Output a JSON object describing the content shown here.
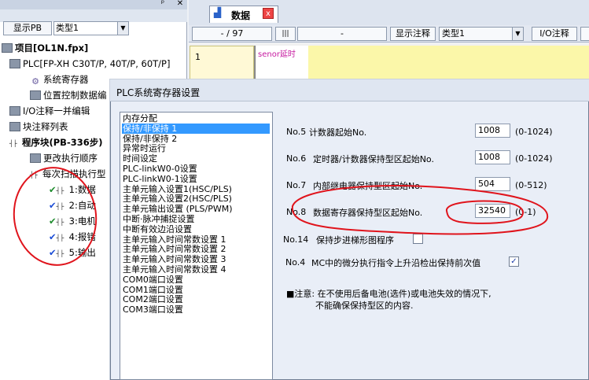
{
  "left_panel": {
    "show_pb_label": "显示PB",
    "type_select_value": "类型1",
    "tree": [
      {
        "label": "项目[OL1N.fpx]",
        "bold": true
      },
      {
        "label": "PLC[FP-XH C30T/P, 40T/P, 60T/P]"
      },
      {
        "label": "系统寄存器"
      },
      {
        "label": "位置控制数据编"
      },
      {
        "label": "I/O注释一并编辑"
      },
      {
        "label": "块注释列表"
      },
      {
        "label": "程序块(PB-336步)",
        "bold": true
      },
      {
        "label": "更改执行顺序"
      },
      {
        "label": "每次扫描执行型"
      },
      {
        "label": "1:数据"
      },
      {
        "label": "2:自动"
      },
      {
        "label": "3:电机"
      },
      {
        "label": "4:报错"
      },
      {
        "label": "5:输出"
      }
    ]
  },
  "editor": {
    "tab_label": "数据",
    "tab_close": "x",
    "position": "- /   97",
    "field_dash": "-",
    "show_comment_button": "显示注释",
    "type_select_value": "类型1",
    "io_comment_button": "I/O注释",
    "rung_number": "1",
    "rung_comment": "senor延时"
  },
  "dialog": {
    "title": "PLC系统寄存器设置",
    "categories": [
      "内存分配",
      "保持/非保持 1",
      "保持/非保持 2",
      "异常时运行",
      "时间设定",
      "PLC-linkW0-0设置",
      "PLC-linkW0-1设置",
      "主单元输入设置1(HSC/PLS)",
      "主单元输入设置2(HSC/PLS)",
      "主单元输出设置 (PLS/PWM)",
      "中断·脉冲捕捉设置",
      "中断有效边沿设置",
      "主单元输入时间常数设置 1",
      "主单元输入时间常数设置 2",
      "主单元输入时间常数设置 3",
      "主单元输入时间常数设置 4",
      "COM0端口设置",
      "COM1端口设置",
      "COM2端口设置",
      "COM3端口设置"
    ],
    "selected_index": 1,
    "settings": [
      {
        "no": "No.5",
        "label": "计数器起始No.",
        "value": "1008",
        "range": "(0-1024)"
      },
      {
        "no": "No.6",
        "label": "定时器/计数器保持型区起始No.",
        "value": "1008",
        "range": "(0-1024)"
      },
      {
        "no": "No.7",
        "label": "内部继电器保持型区起始No.",
        "value": "504",
        "range": "(0-512)"
      },
      {
        "no": "No.8",
        "label": "数据寄存器保持型区起始No.",
        "value": "32540",
        "range": "(0-1)"
      }
    ],
    "checks": [
      {
        "no": "No.14",
        "label": "保持步进梯形图程序",
        "checked": false,
        "mark": ""
      },
      {
        "no": "No.4",
        "label": "MC中的微分执行指令上升沿检出保持前次值",
        "checked": true,
        "mark": "✓"
      }
    ],
    "note_line1": "■注意: 在不使用后备电池(选件)或电池失效的情况下,",
    "note_line2": "不能确保保持型区的内容."
  },
  "colors": {
    "selection": "#3399ff",
    "annotation_red": "#e0141c",
    "comment_magenta": "#c61ba0"
  }
}
